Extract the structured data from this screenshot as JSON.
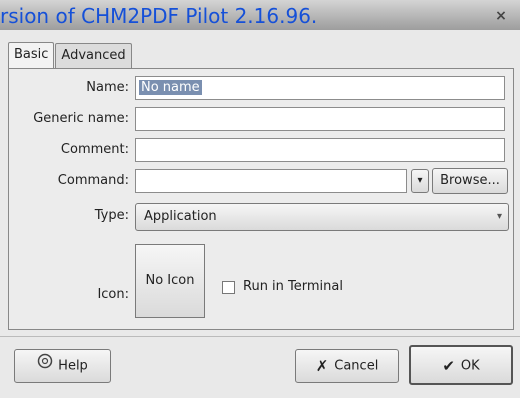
{
  "window": {
    "watermark": "rsion of CHM2PDF Pilot 2.16.96.",
    "close_glyph": "×"
  },
  "tabs": [
    {
      "label": "Basic",
      "active": true
    },
    {
      "label": "Advanced",
      "active": false
    }
  ],
  "form": {
    "name_label": "Name:",
    "name_value": "No name",
    "generic_label": "Generic name:",
    "comment_label": "Comment:",
    "command_label": "Command:",
    "browse_label": "Browse...",
    "type_label": "Type:",
    "type_value": "Application",
    "icon_label": "Icon:",
    "icon_button": "No Icon",
    "run_terminal_label": "Run in Terminal"
  },
  "buttons": {
    "help": "Help",
    "cancel": "Cancel",
    "ok": "OK"
  },
  "icons": {
    "help": "help-lifebuoy-icon",
    "cancel": "cancel-x-icon",
    "ok": "ok-hand-icon",
    "dropdown": "chevron-down-icon",
    "close": "close-icon"
  }
}
